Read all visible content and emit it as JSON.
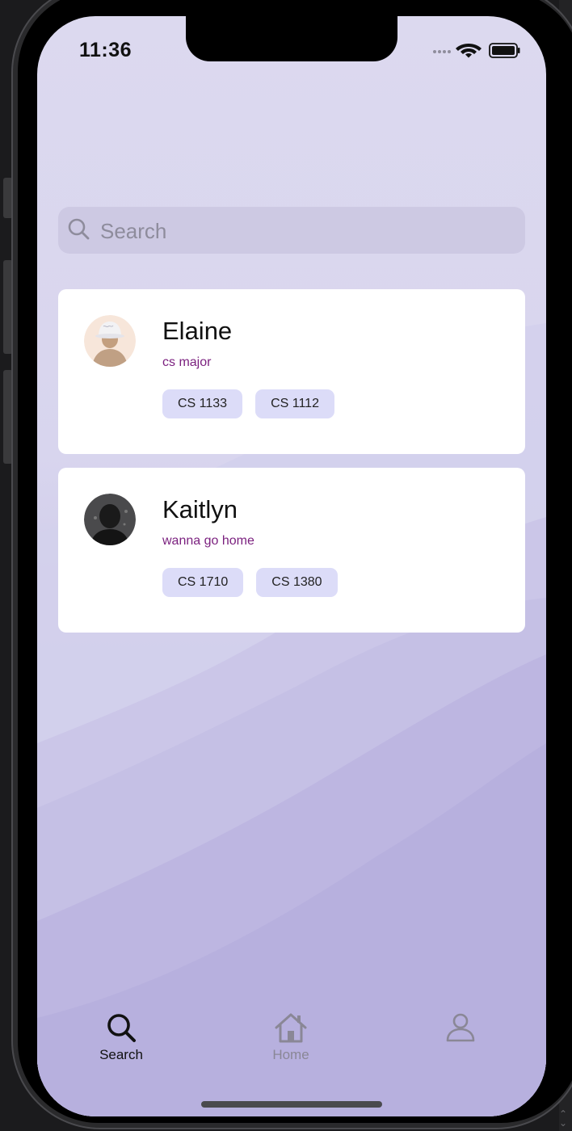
{
  "status_bar": {
    "time": "11:36"
  },
  "search": {
    "placeholder": "Search",
    "value": ""
  },
  "users": [
    {
      "name": "Elaine",
      "bio": "cs major",
      "avatar": "bucket-hat-avatar",
      "courses": [
        "CS 1133",
        "CS 1112"
      ]
    },
    {
      "name": "Kaitlyn",
      "bio": "wanna go home",
      "avatar": "dark-silhouette-avatar",
      "courses": [
        "CS 1710",
        "CS 1380"
      ]
    }
  ],
  "tabbar": {
    "items": [
      {
        "label": "Search",
        "icon": "search-icon",
        "active": true
      },
      {
        "label": "Home",
        "icon": "house-icon",
        "active": false
      },
      {
        "label": "",
        "icon": "person-icon",
        "active": false
      }
    ]
  },
  "colors": {
    "bio_text": "#7a1f7e",
    "chip_bg": "#dcdcf8",
    "active_tab": "#111111",
    "inactive_tab": "#8a8796"
  }
}
